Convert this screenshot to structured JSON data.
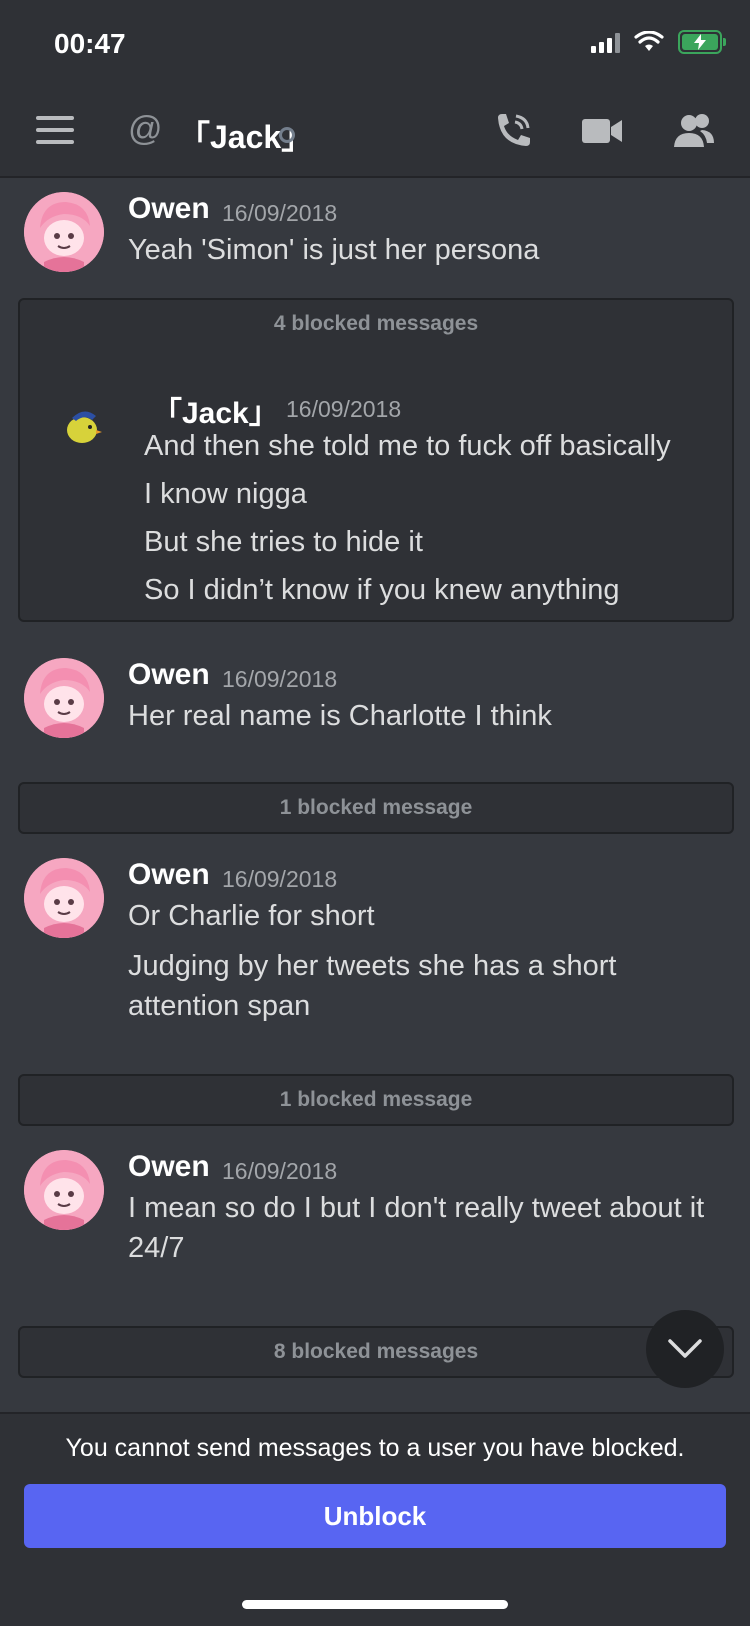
{
  "status_bar": {
    "time": "00:47"
  },
  "header": {
    "channel_name": "「Jack」",
    "icons": [
      "menu-icon",
      "at-icon",
      "voice-call-icon",
      "video-call-icon",
      "members-icon"
    ]
  },
  "messages": [
    {
      "author": "Owen",
      "date": "16/09/2018",
      "lines": [
        "Yeah 'Simon' is just her persona"
      ]
    },
    {
      "blocked_label": "4 blocked messages",
      "author": "「Jack」",
      "date": "16/09/2018",
      "lines": [
        "And then she told me to fuck off basically",
        "I know nigga",
        "But she tries to hide it",
        "So I didn’t know if you knew anything"
      ]
    },
    {
      "author": "Owen",
      "date": "16/09/2018",
      "lines": [
        "Her real name is Charlotte I think"
      ]
    },
    {
      "blocked_label": "1 blocked message"
    },
    {
      "author": "Owen",
      "date": "16/09/2018",
      "lines": [
        "Or Charlie for short",
        "Judging by her tweets she has a short attention span"
      ]
    },
    {
      "blocked_label": "1 blocked message"
    },
    {
      "author": "Owen",
      "date": "16/09/2018",
      "lines": [
        "I mean so do I but I don't really tweet about it 24/7"
      ]
    },
    {
      "blocked_label": "8 blocked messages"
    }
  ],
  "footer": {
    "notice": "You cannot send messages to a user you have blocked.",
    "unblock_label": "Unblock"
  },
  "colors": {
    "accent": "#5865f2",
    "background": "#36393f",
    "battery": "#3ba55c"
  }
}
